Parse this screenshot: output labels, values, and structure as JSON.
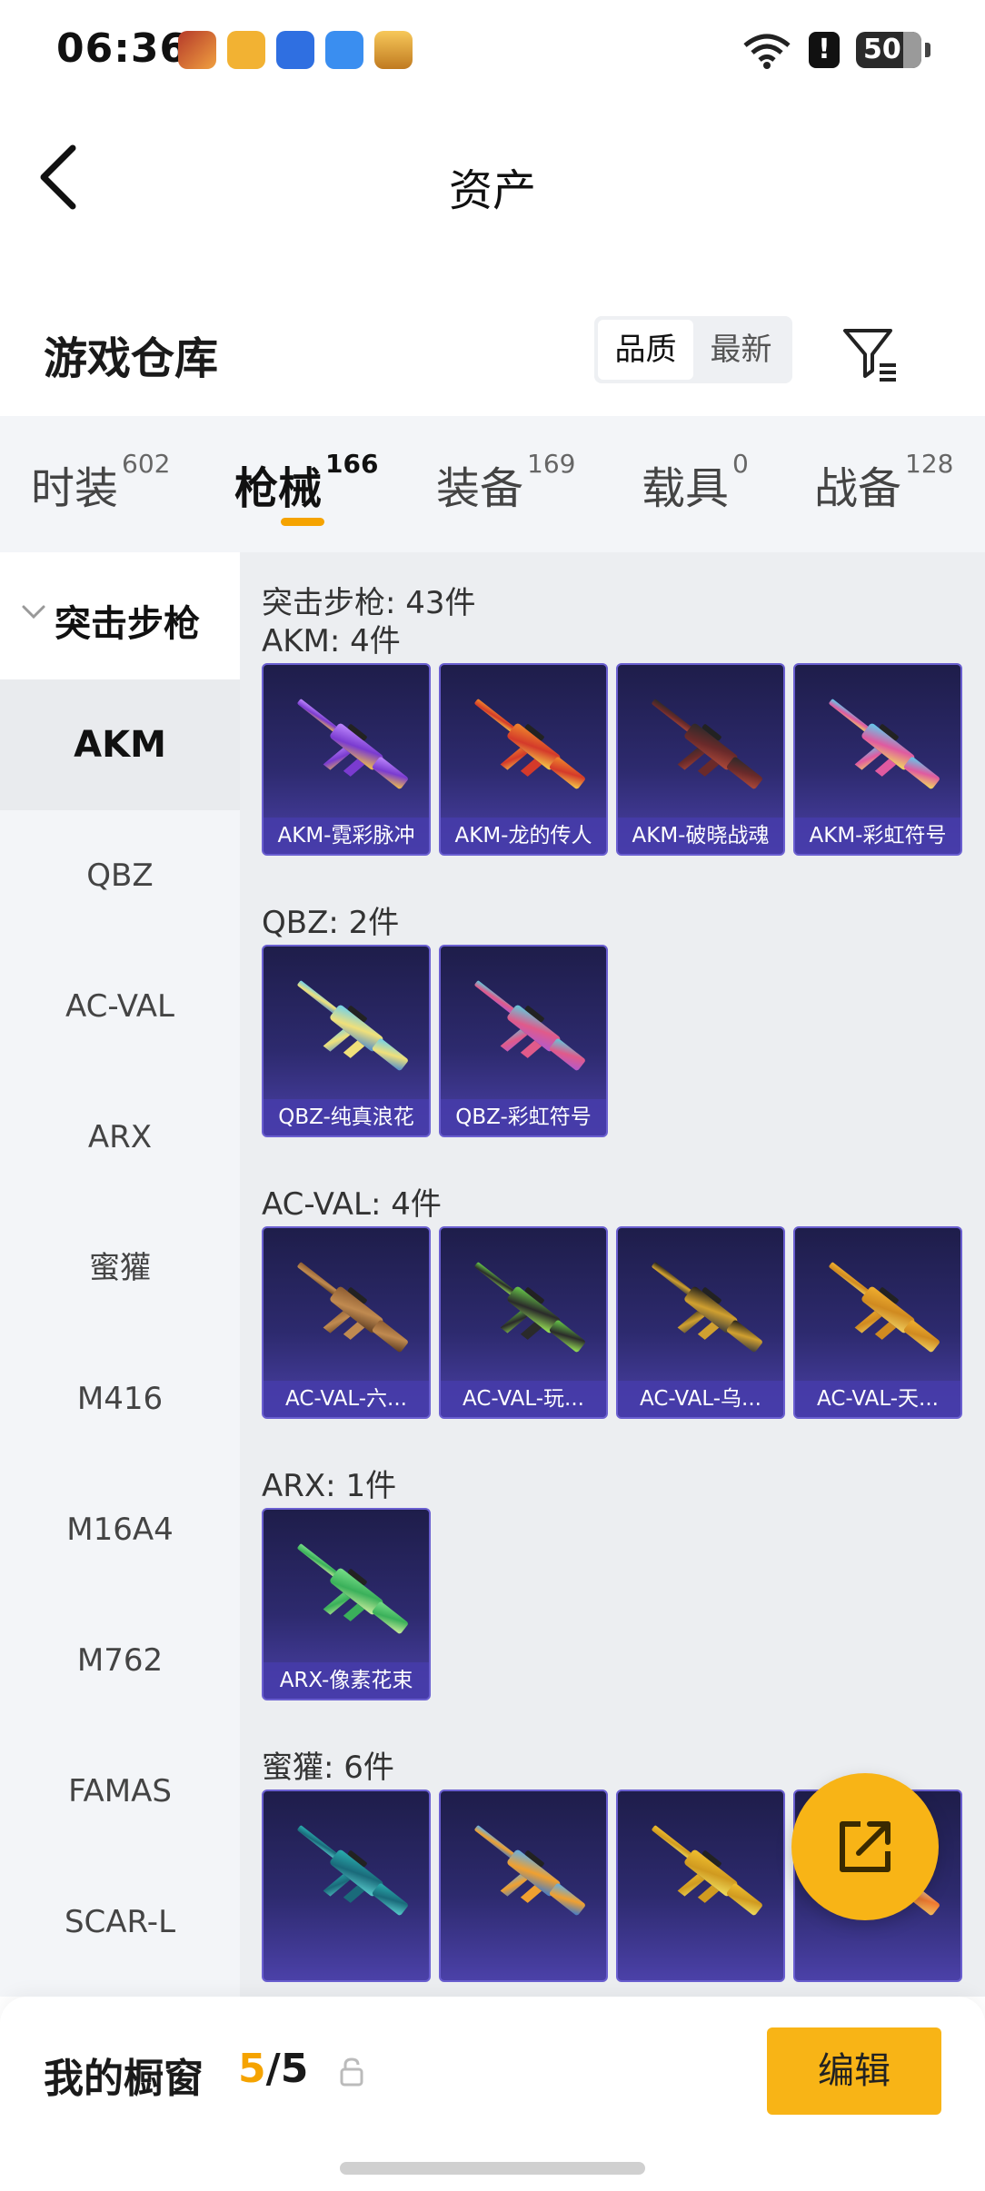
{
  "status_bar": {
    "time": "06:36",
    "notification_colors": [
      "#e07b39",
      "#f2b233",
      "#2f7de1",
      "#3a8ef0",
      "#e9a830"
    ],
    "battery_level": "50",
    "alert_glyph": "!"
  },
  "header": {
    "title": "资产"
  },
  "warehouse": {
    "title": "游戏仓库",
    "sort_options": [
      "品质",
      "最新"
    ],
    "active_sort": "品质"
  },
  "tabs": [
    {
      "label": "时装",
      "count": "602"
    },
    {
      "label": "枪械",
      "count": "166"
    },
    {
      "label": "装备",
      "count": "169"
    },
    {
      "label": "载具",
      "count": "0"
    },
    {
      "label": "战备",
      "count": "128"
    }
  ],
  "active_tab": "枪械",
  "left_nav": {
    "category": "突击步枪",
    "items": [
      "AKM",
      "QBZ",
      "AC-VAL",
      "ARX",
      "蜜獾",
      "M416",
      "M16A4",
      "M762",
      "FAMAS",
      "SCAR-L"
    ],
    "active_item": "AKM"
  },
  "content": {
    "section_total": "突击步枪: 43件",
    "groups": [
      {
        "title": "AKM: 4件",
        "items": [
          {
            "name": "AKM-霓彩脉冲",
            "colors": [
              "#c08bff",
              "#7a3bd0",
              "#f5c542"
            ]
          },
          {
            "name": "AKM-龙的传人",
            "colors": [
              "#f08a2c",
              "#d43a2a",
              "#f7d24a"
            ]
          },
          {
            "name": "AKM-破晓战魂",
            "colors": [
              "#2a2a2a",
              "#6a2a2a",
              "#b04a3a"
            ]
          },
          {
            "name": "AKM-彩虹符号",
            "colors": [
              "#5ad0f0",
              "#e05aa0",
              "#f0e05a"
            ]
          }
        ]
      },
      {
        "title": "QBZ: 2件",
        "items": [
          {
            "name": "QBZ-纯真浪花",
            "colors": [
              "#6ad0f0",
              "#f0e07a",
              "#4a8ad0"
            ]
          },
          {
            "name": "QBZ-彩虹符号",
            "colors": [
              "#5ad0e0",
              "#e05a8a",
              "#b05ad0"
            ]
          }
        ]
      },
      {
        "title": "AC-VAL: 4件",
        "items": [
          {
            "name": "AC-VAL-六...",
            "colors": [
              "#8a5a30",
              "#c08a50",
              "#5a3a20"
            ]
          },
          {
            "name": "AC-VAL-玩...",
            "colors": [
              "#6ad04a",
              "#2a2a2a",
              "#a0f05a"
            ]
          },
          {
            "name": "AC-VAL-乌...",
            "colors": [
              "#1a1a1a",
              "#d0a030",
              "#3a3a3a"
            ]
          },
          {
            "name": "AC-VAL-天...",
            "colors": [
              "#f0b030",
              "#d08a20",
              "#f0d060"
            ]
          }
        ]
      },
      {
        "title": "ARX: 1件",
        "items": [
          {
            "name": "ARX-像素花束",
            "colors": [
              "#7ae08a",
              "#3ab05a",
              "#d0f0a0"
            ]
          }
        ]
      },
      {
        "title": "蜜獾: 6件",
        "items": [
          {
            "name": "",
            "colors": [
              "#2ab0b0",
              "#1a6a7a",
              "#5ad0d0"
            ]
          },
          {
            "name": "",
            "colors": [
              "#5ab0f0",
              "#f0a030",
              "#3a7ad0"
            ]
          },
          {
            "name": "",
            "colors": [
              "#f0c030",
              "#d09a20",
              "#f0e060"
            ]
          },
          {
            "name": "",
            "colors": [
              "#f0e0c0",
              "#f07a30",
              "#f0c060"
            ]
          }
        ]
      }
    ]
  },
  "bottom_bar": {
    "label": "我的橱窗",
    "current": "5",
    "total": "5",
    "edit_label": "编辑"
  },
  "accent_color": "#f8b416"
}
